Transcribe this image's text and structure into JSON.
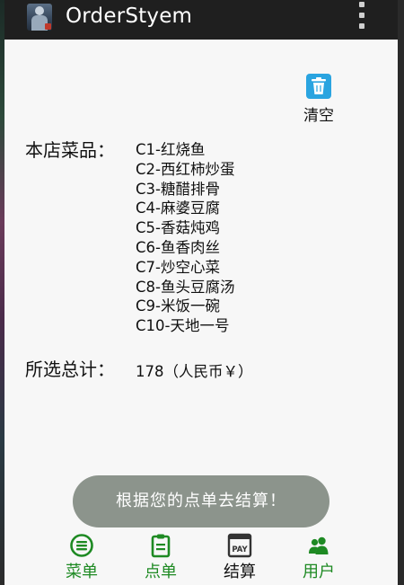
{
  "app": {
    "title": "OrderStyem"
  },
  "toolbar": {
    "clear_label": "清空"
  },
  "menu": {
    "heading": "本店菜品：",
    "items": [
      "C1-红烧鱼",
      "C2-西红柿炒蛋",
      "C3-糖醋排骨",
      "C4-麻婆豆腐",
      "C5-香菇炖鸡",
      "C6-鱼香肉丝",
      "C7-炒空心菜",
      "C8-鱼头豆腐汤",
      "C9-米饭一碗",
      "C10-天地一号"
    ]
  },
  "total": {
    "heading": "所选总计：",
    "value": "178（人民币￥）"
  },
  "toast": {
    "message": "根据您的点单去结算！"
  },
  "tabs": [
    {
      "label": "菜单",
      "icon": "menu-list-icon",
      "active": false
    },
    {
      "label": "点单",
      "icon": "clipboard-icon",
      "active": false
    },
    {
      "label": "结算",
      "icon": "pay-icon",
      "active": true
    },
    {
      "label": "用户",
      "icon": "users-icon",
      "active": false
    }
  ],
  "colors": {
    "accent_green": "#1e8a23",
    "action_bar": "#1f1f1f",
    "clear_icon": "#2aa4e0",
    "toast_bg": "#8c948c"
  }
}
